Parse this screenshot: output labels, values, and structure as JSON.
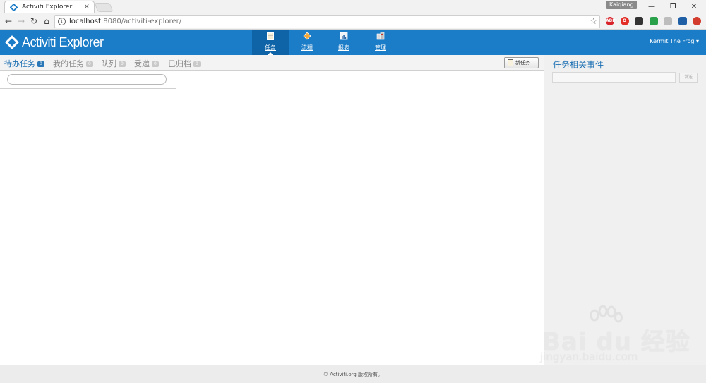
{
  "browser": {
    "tab_title": "Activiti Explorer",
    "tab_close": "×",
    "profile_name": "Kaiqiang",
    "window_controls": {
      "minimize": "—",
      "restore": "❐",
      "close": "✕"
    },
    "nav": {
      "back": "←",
      "forward": "→",
      "reload": "↻",
      "home": "⌂"
    },
    "url_host": "localhost",
    "url_rest": ":8080/activiti-explorer/",
    "info_icon": "i",
    "bookmark_star": "☆",
    "extensions": [
      {
        "name": "adblock-plus-icon",
        "label": "ABP",
        "color": "#d8232a"
      },
      {
        "name": "opera-icon",
        "label": "O",
        "color": "#e32d27"
      },
      {
        "name": "spy-icon",
        "label": "",
        "color": "#333333"
      },
      {
        "name": "chrome-app-icon",
        "label": "",
        "color": "#2aa14b"
      },
      {
        "name": "notepad-icon",
        "label": "",
        "color": "#bdbdbd"
      },
      {
        "name": "save-icon",
        "label": "",
        "color": "#1e5fa6"
      },
      {
        "name": "record-icon",
        "label": "",
        "color": "#d33b2c"
      }
    ]
  },
  "app": {
    "logo_text": "Activiti Explorer",
    "main_nav": [
      {
        "label": "任务",
        "active": true,
        "icon": "clipboard-icon"
      },
      {
        "label": "流程",
        "active": false,
        "icon": "process-diamond-icon"
      },
      {
        "label": "报表",
        "active": false,
        "icon": "report-chart-icon"
      },
      {
        "label": "管理",
        "active": false,
        "icon": "manage-server-icon"
      }
    ],
    "user_menu": "Kermit The Frog ▾",
    "colors": {
      "header": "#1b7cc7",
      "accent": "#1b6fb3"
    }
  },
  "tasks": {
    "subtabs": [
      {
        "label": "待办任务",
        "count": "0",
        "active": true
      },
      {
        "label": "我的任务",
        "count": "0",
        "active": false
      },
      {
        "label": "队列",
        "count": "0",
        "active": false
      },
      {
        "label": "受邀",
        "count": "0",
        "active": false
      },
      {
        "label": "已归档",
        "count": "0",
        "active": false
      }
    ],
    "new_task_label": "新任务",
    "search_value": ""
  },
  "events_panel": {
    "title": "任务相关事件",
    "input_value": "",
    "send_label": "发送"
  },
  "footer": {
    "text": "© Activiti.org 版权所有。"
  },
  "watermark": {
    "brand": "Bai du 经验",
    "url": "jingyan.baidu.com"
  }
}
